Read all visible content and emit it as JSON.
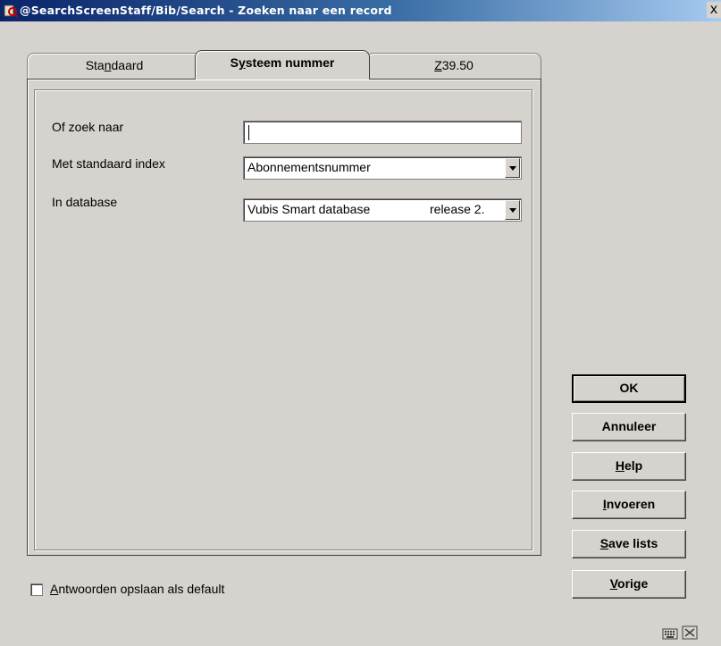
{
  "window": {
    "title": "@SearchScreenStaff/Bib/Search - Zoeken naar een record",
    "close_label": "x"
  },
  "tabs": [
    {
      "label_pre": "Sta",
      "label_ul": "n",
      "label_post": "daard",
      "active": false
    },
    {
      "label_pre": "S",
      "label_ul": "y",
      "label_post": "steem nummer",
      "active": true
    },
    {
      "label_pre": "",
      "label_ul": "Z",
      "label_post": "39.50",
      "active": false
    }
  ],
  "form": {
    "search_label": "Of zoek naar",
    "search_value": "",
    "index_label": "Met standaard index",
    "index_value": "Abonnementsnummer",
    "database_label": "In database",
    "database_value": "Vubis Smart database",
    "database_release": "release 2."
  },
  "buttons": {
    "ok": "OK",
    "annuleer": "Annuleer",
    "help_ul": "H",
    "help_rest": "elp",
    "invoeren_ul": "I",
    "invoeren_rest": "nvoeren",
    "save_ul": "S",
    "save_rest": "ave lists",
    "vorige_ul": "V",
    "vorige_rest": "orige"
  },
  "options": {
    "save_default_ul": "A",
    "save_default_rest": "ntwoorden opslaan als default",
    "save_default_checked": false
  }
}
